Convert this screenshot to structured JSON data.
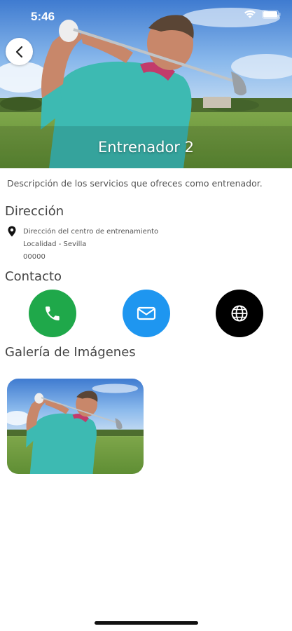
{
  "status_bar": {
    "time": "5:46"
  },
  "hero": {
    "title": "Entrenador 2"
  },
  "description": "Descripción de los servicios que ofreces como entrenador.",
  "address": {
    "heading": "Dirección",
    "line1": "Dirección del centro de entrenamiento",
    "line2": "Localidad - Sevilla",
    "line3": "00000"
  },
  "contact": {
    "heading": "Contacto",
    "buttons": [
      {
        "icon": "phone-icon",
        "color": "#1fa84a"
      },
      {
        "icon": "mail-icon",
        "color": "#1e96f0"
      },
      {
        "icon": "globe-icon",
        "color": "#000000"
      }
    ]
  },
  "gallery": {
    "heading": "Galería de Imágenes"
  },
  "colors": {
    "text": "#444444",
    "background": "#ffffff"
  }
}
